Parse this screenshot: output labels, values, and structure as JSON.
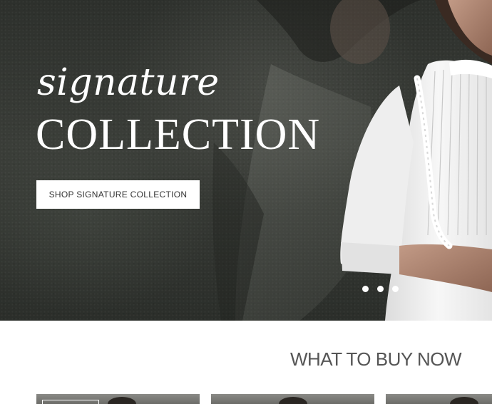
{
  "hero": {
    "title_script": "signature",
    "title_caps": "COLLECTION",
    "cta_label": "SHOP SIGNATURE COLLECTION",
    "carousel": {
      "slide_count": 3,
      "active_slide": 1
    }
  },
  "section": {
    "title": "WHAT TO BUY NOW"
  },
  "products": [
    {
      "name": "product-card-1"
    },
    {
      "name": "product-card-2"
    },
    {
      "name": "product-card-3"
    }
  ],
  "colors": {
    "hero_background": "#33362f",
    "cta_background": "#ffffff",
    "cta_text": "#333333",
    "section_title": "#555555"
  }
}
